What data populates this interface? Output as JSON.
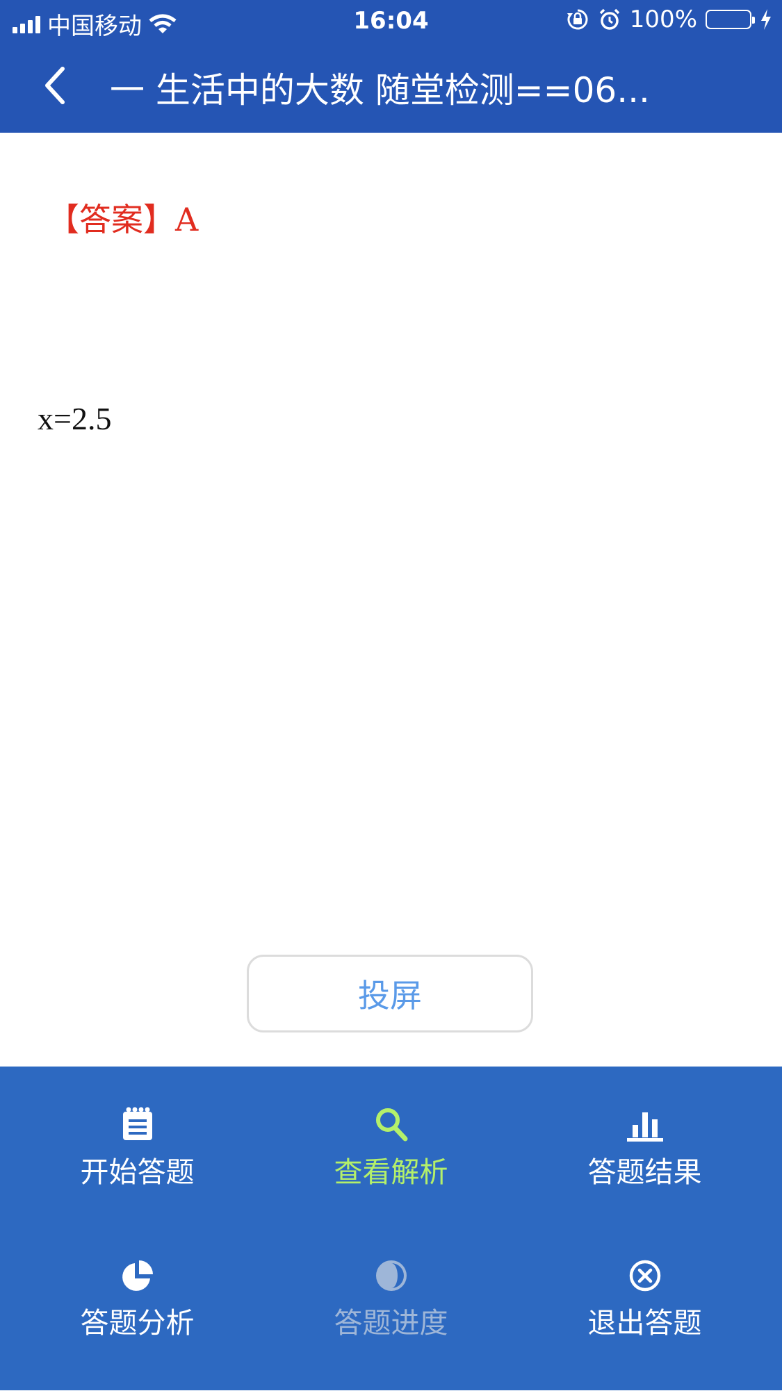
{
  "status_bar": {
    "carrier": "中国移动",
    "time": "16:04",
    "battery": "100%",
    "battery_level": 1.0
  },
  "nav": {
    "title": "一 生活中的大数 随堂检测==06..."
  },
  "content": {
    "answer": "【答案】A",
    "formula": "x=2.5"
  },
  "cast_button": {
    "label": "投屏"
  },
  "toolbar": {
    "active_color": "#b4f06a",
    "disabled_color": "#9eb6d8",
    "items": [
      {
        "label": "开始答题",
        "icon": "notepad-icon",
        "state": "normal"
      },
      {
        "label": "查看解析",
        "icon": "search-icon",
        "state": "active"
      },
      {
        "label": "答题结果",
        "icon": "bar-chart-icon",
        "state": "normal"
      },
      {
        "label": "答题分析",
        "icon": "pie-chart-icon",
        "state": "normal"
      },
      {
        "label": "答题进度",
        "icon": "progress-icon",
        "state": "disabled"
      },
      {
        "label": "退出答题",
        "icon": "close-circle-icon",
        "state": "normal"
      }
    ]
  }
}
